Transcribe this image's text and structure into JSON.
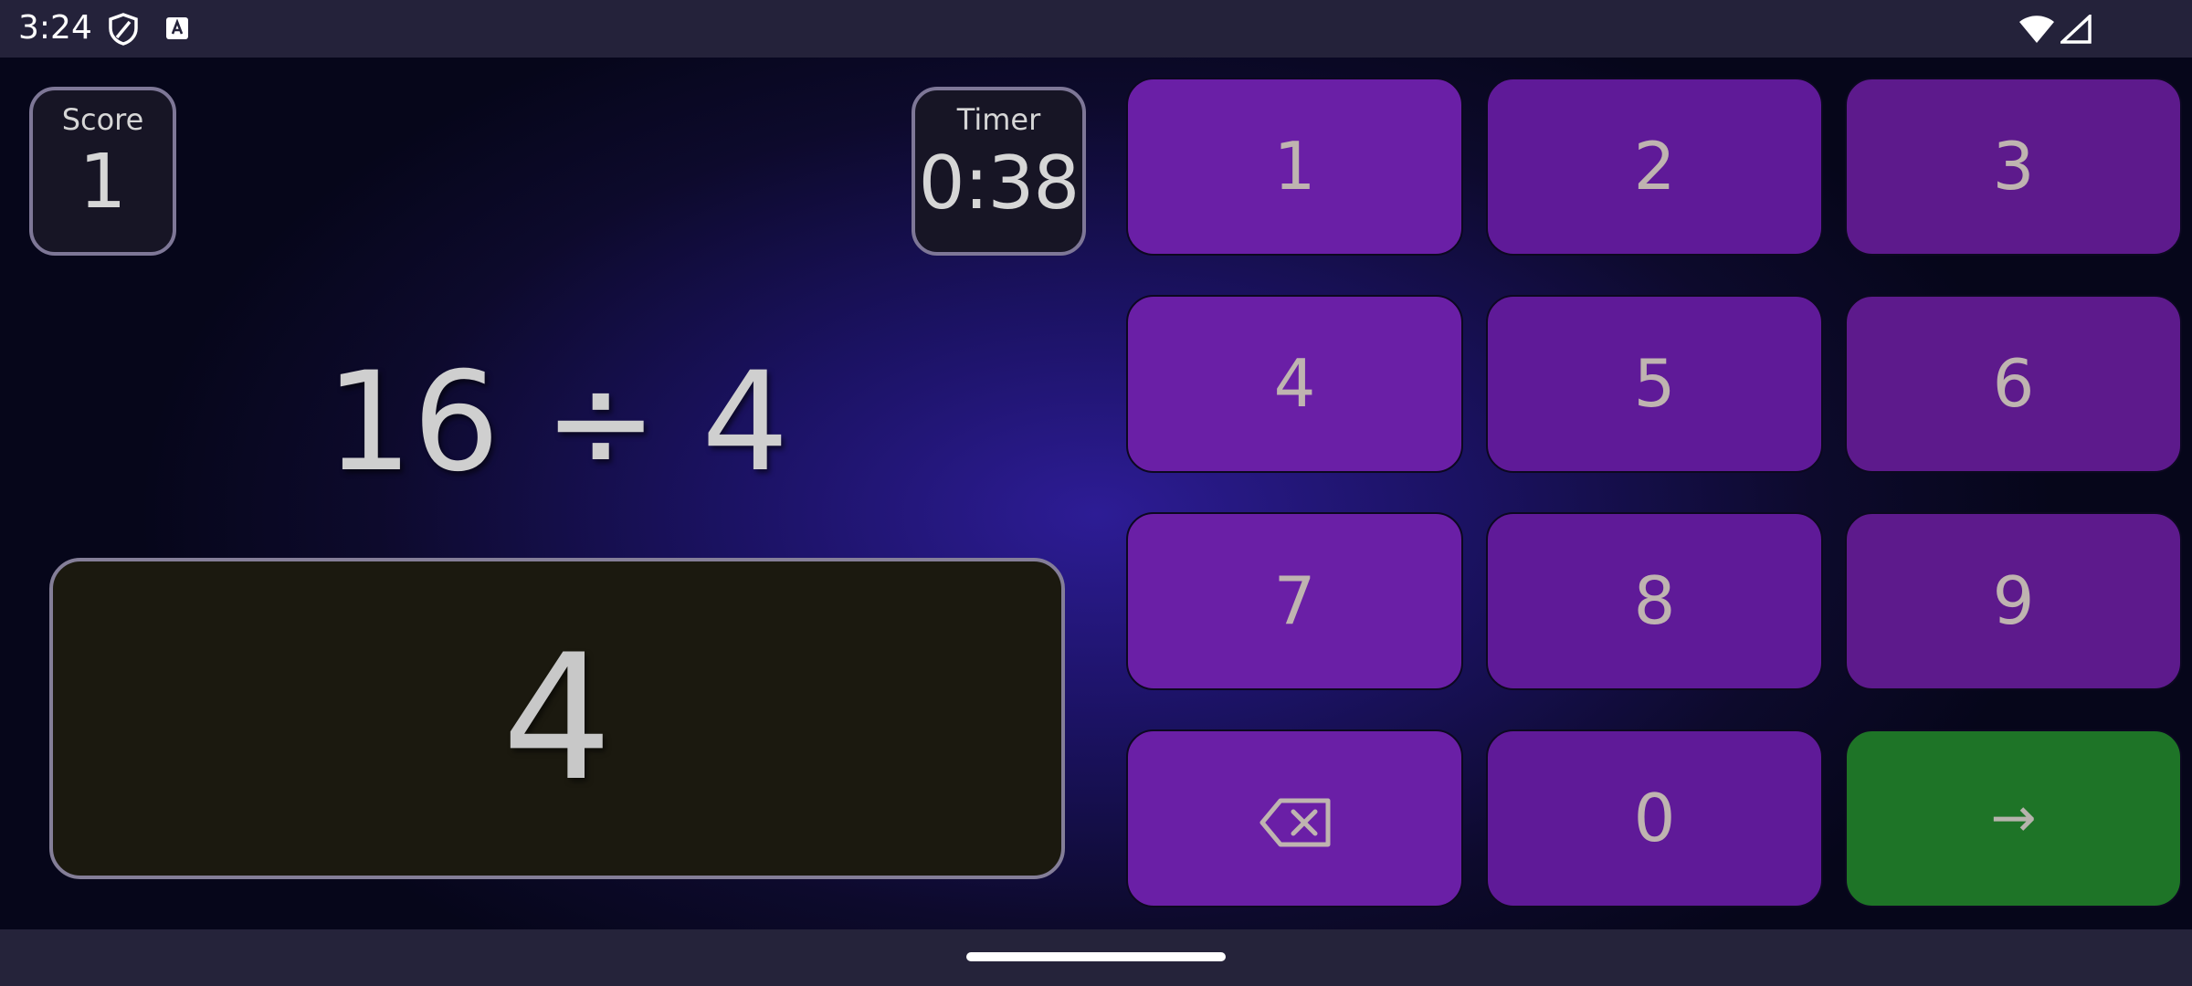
{
  "status_bar": {
    "time": "3:24",
    "left_icons": [
      "shield-icon",
      "keyboard-notification-icon"
    ],
    "right_icons": [
      "wifi-icon",
      "cellular-signal-icon"
    ]
  },
  "game": {
    "score": {
      "label": "Score",
      "value": "1"
    },
    "timer": {
      "label": "Timer",
      "value": "0:38"
    },
    "problem": "16 ÷ 4",
    "answer": "4"
  },
  "keypad": {
    "rows": [
      [
        "1",
        "2",
        "3"
      ],
      [
        "4",
        "5",
        "6"
      ],
      [
        "7",
        "8",
        "9"
      ]
    ],
    "backspace_icon": "backspace-icon",
    "zero": "0",
    "enter_label": "→"
  },
  "colors": {
    "key_purple": "#661d9c",
    "enter_green": "#1e7427",
    "answer_bg": "#1b190f",
    "box_border": "#7e7797"
  }
}
